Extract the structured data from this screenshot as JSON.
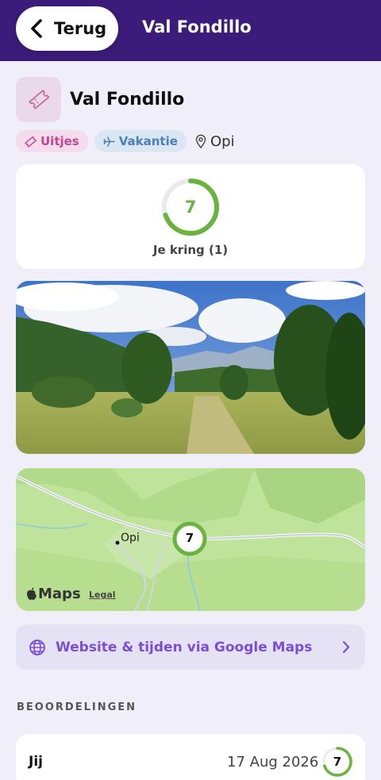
{
  "nav": {
    "back_label": "Terug",
    "title": "Val Fondillo"
  },
  "place": {
    "title": "Val Fondillo",
    "icon": "ticket-icon"
  },
  "tags": [
    {
      "label": "Uitjes",
      "icon": "ticket-icon",
      "color": "#c2478f"
    },
    {
      "label": "Vakantie",
      "icon": "airplane-icon",
      "color": "#4a7fb8"
    }
  ],
  "location": {
    "label": "Opi",
    "icon": "map-pin-icon"
  },
  "score": {
    "value": "7",
    "label": "Je kring (1)",
    "fill_fraction": 0.7,
    "color": "#6ab33c"
  },
  "map": {
    "place_label": "Opi",
    "marker_value": "7",
    "brand": "Maps",
    "legal": "Legal"
  },
  "link": {
    "label": "Website & tijden via Google Maps",
    "icon": "globe-icon"
  },
  "reviews": {
    "section_title": "BEOORDELINGEN",
    "items": [
      {
        "name": "Jij",
        "date": "17 Aug 2026",
        "score": "7",
        "fill_fraction": 0.7
      }
    ]
  }
}
